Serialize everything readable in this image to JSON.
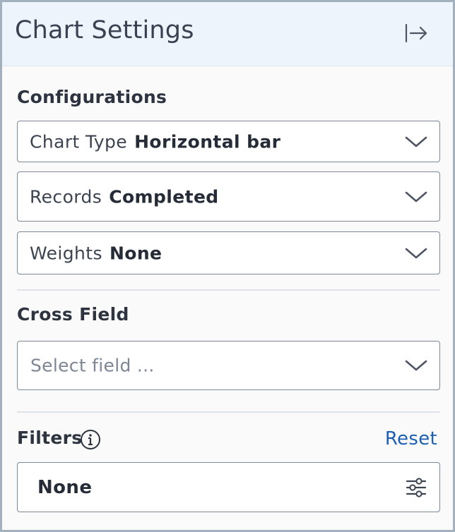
{
  "header": {
    "title": "Chart Settings",
    "collapse_icon": "collapse-right-icon"
  },
  "configurations": {
    "title": "Configurations",
    "chart_type": {
      "label": "Chart Type",
      "value": "Horizontal bar"
    },
    "records": {
      "label": "Records",
      "value": "Completed"
    },
    "weights": {
      "label": "Weights",
      "value": "None"
    }
  },
  "cross_field": {
    "title": "Cross Field",
    "placeholder": "Select field ..."
  },
  "filters": {
    "title": "Filters",
    "info_icon": "info-icon",
    "reset_label": "Reset",
    "value": "None",
    "settings_icon": "sliders-icon"
  },
  "colors": {
    "header_bg": "#eef4fc",
    "border": "#a3b1bf",
    "link": "#1d5fb3",
    "text": "#2d3440"
  }
}
